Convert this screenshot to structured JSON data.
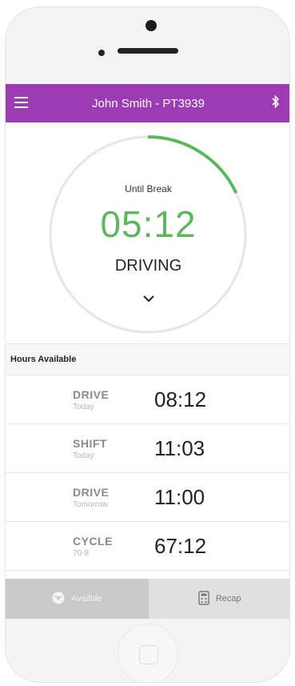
{
  "header": {
    "title": "John Smith - PT3939",
    "menu_icon": "hamburger-menu-icon",
    "bluetooth_icon": "bluetooth-icon",
    "color": "#9c3bb3"
  },
  "dial": {
    "label": "Until Break",
    "time": "05:12",
    "status": "DRIVING",
    "progress": 0.18,
    "progress_color": "#5cb85c",
    "track_color": "#e6e6e6"
  },
  "hours": {
    "title": "Hours Available",
    "rows": [
      {
        "label": "DRIVE",
        "sub": "Today",
        "value": "08:12"
      },
      {
        "label": "SHIFT",
        "sub": "Today",
        "value": "11:03"
      },
      {
        "label": "DRIVE",
        "sub": "Tomorrow",
        "value": "11:00"
      },
      {
        "label": "CYCLE",
        "sub": "70-8",
        "value": "67:12"
      }
    ]
  },
  "tabs": {
    "available": "Availble",
    "recap": "Recap"
  }
}
